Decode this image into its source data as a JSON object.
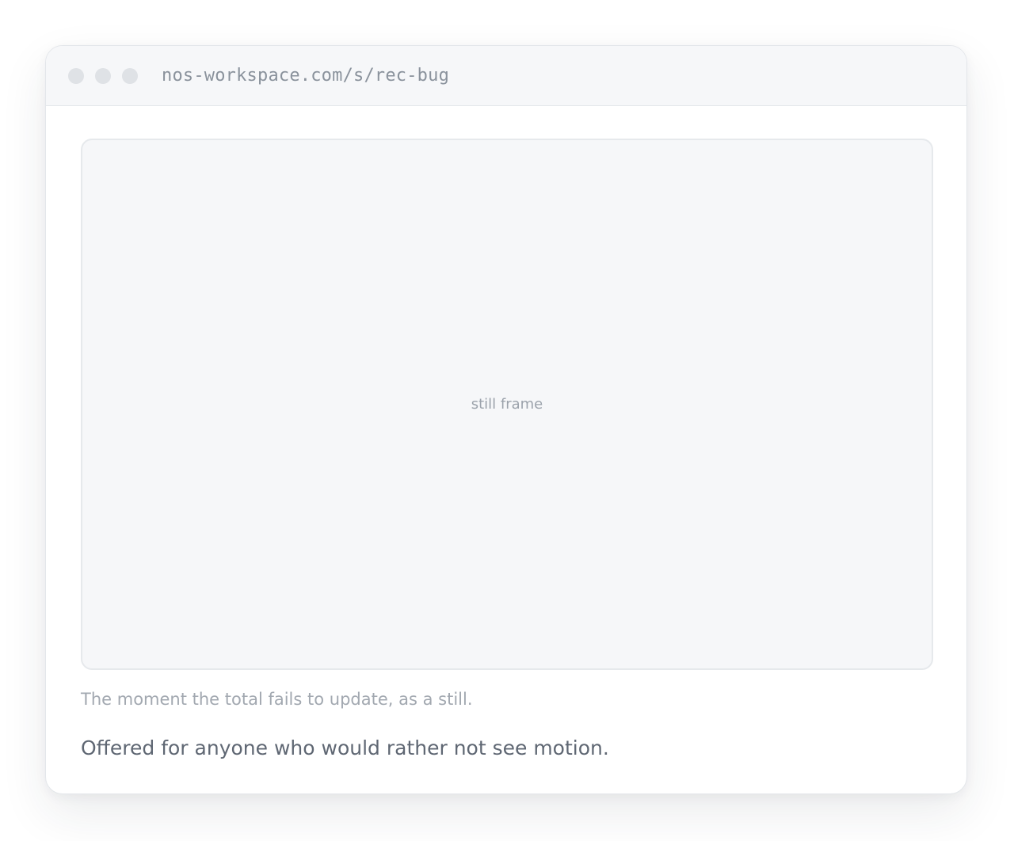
{
  "browser": {
    "url": "nos-workspace.com/s/rec-bug",
    "window_controls": [
      "close-dot",
      "minimize-dot",
      "maximize-dot"
    ]
  },
  "main": {
    "frame_label": "still frame",
    "caption": "The moment the total fails to update, as a still.",
    "note": "Offered for anyone who would rather not see motion."
  },
  "colors": {
    "titlebar_bg": "#f6f7f9",
    "frame_bg": "#f6f7f9",
    "border": "#e3e6ea",
    "dot": "#dfe2e6",
    "url_text": "#8a929c",
    "caption_text": "#a2a8b0",
    "note_text": "#5f6773"
  }
}
